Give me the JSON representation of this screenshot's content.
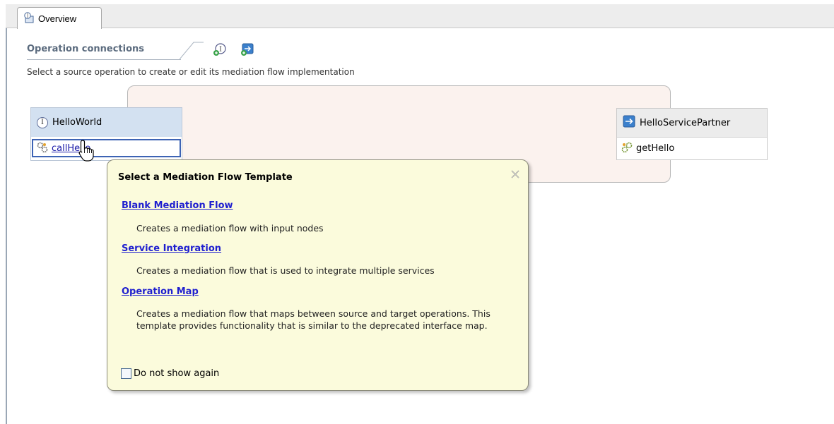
{
  "tabs": [
    {
      "label": "Overview",
      "icon": "interface-icon"
    }
  ],
  "section": {
    "title": "Operation connections",
    "subtitle": "Select a source operation to create or edit its mediation flow implementation",
    "add_interface_icon": "add-interface-icon",
    "add_reference_icon": "add-reference-icon"
  },
  "interface": {
    "name": "HelloWorld",
    "operation": "callHello"
  },
  "reference": {
    "name": "HelloServicePartner",
    "operation": "getHello"
  },
  "popup": {
    "title": "Select a Mediation Flow Template",
    "templates": [
      {
        "label": "Blank Mediation Flow",
        "description": "Creates a mediation flow with input nodes"
      },
      {
        "label": "Service Integration",
        "description": "Creates a mediation flow that is used to integrate multiple services"
      },
      {
        "label": "Operation Map",
        "description": "Creates a mediation flow that maps between source and target operations. This template provides functionality that is similar to the deprecated interface map."
      }
    ],
    "checkbox_label": "Do not show again",
    "checkbox_checked": false
  },
  "colors": {
    "link": "#1f1fcf",
    "popup_bg": "#fbfbdc",
    "interface_header": "#d3e1f1",
    "section_title": "#5b6b7e"
  }
}
